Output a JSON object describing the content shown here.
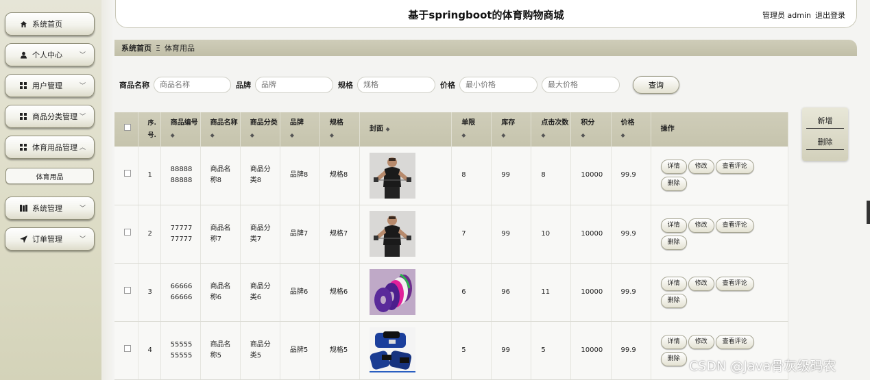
{
  "header": {
    "title": "基于springboot的体育购物商城",
    "role_user": "管理员 admin",
    "logout": "退出登录"
  },
  "sidebar": {
    "items": [
      {
        "label": "系统首页",
        "icon": "home-icon"
      },
      {
        "label": "个人中心",
        "icon": "user-icon"
      },
      {
        "label": "用户管理",
        "icon": "grid-icon"
      },
      {
        "label": "商品分类管理",
        "icon": "grid-icon"
      },
      {
        "label": "体育用品管理",
        "icon": "grid-icon"
      },
      {
        "label": "系统管理",
        "icon": "book-icon"
      },
      {
        "label": "订单管理",
        "icon": "send-icon"
      }
    ],
    "sub_item": "体育用品"
  },
  "breadcrumb": {
    "home": "系统首页",
    "sep": "Ξ",
    "current": "体育用品"
  },
  "search": {
    "name_label": "商品名称",
    "name_placeholder": "商品名称",
    "brand_label": "品牌",
    "brand_placeholder": "品牌",
    "spec_label": "规格",
    "spec_placeholder": "规格",
    "price_label": "价格",
    "min_placeholder": "最小价格",
    "max_placeholder": "最大价格",
    "query_button": "查询"
  },
  "side_actions": {
    "add": "新增",
    "delete": "删除"
  },
  "table": {
    "headers": {
      "index": "序.号.",
      "code": "商品编号",
      "name": "商品名称",
      "category": "商品分类",
      "brand": "品牌",
      "spec": "规格",
      "cover": "封面",
      "limit": "单限",
      "stock": "库存",
      "clicks": "点击次数",
      "points": "积分",
      "price": "价格",
      "ops": "操作"
    },
    "op_labels": {
      "detail": "详情",
      "edit": "修改",
      "review": "查看评论",
      "delete": "删除"
    },
    "rows": [
      {
        "index": "1",
        "code": "88888 88888",
        "name": "商品名称8",
        "category": "商品分类8",
        "brand": "品牌8",
        "spec": "规格8",
        "cover": "fitness-man-image",
        "limit": "8",
        "stock": "99",
        "clicks": "8",
        "points": "10000",
        "price": "99.9"
      },
      {
        "index": "2",
        "code": "77777 77777",
        "name": "商品名称7",
        "category": "商品分类7",
        "brand": "品牌7",
        "spec": "规格7",
        "cover": "fitness-man-image",
        "limit": "7",
        "stock": "99",
        "clicks": "10",
        "points": "10000",
        "price": "99.9"
      },
      {
        "index": "3",
        "code": "66666 66666",
        "name": "商品名称6",
        "category": "商品分类6",
        "brand": "品牌6",
        "spec": "规格6",
        "cover": "weight-plates-image",
        "limit": "6",
        "stock": "96",
        "clicks": "11",
        "points": "10000",
        "price": "99.9"
      },
      {
        "index": "4",
        "code": "55555 55555",
        "name": "商品名称5",
        "category": "商品分类5",
        "brand": "品牌5",
        "spec": "规格5",
        "cover": "ankle-weights-image",
        "limit": "5",
        "stock": "99",
        "clicks": "5",
        "points": "10000",
        "price": "99.9"
      }
    ]
  },
  "watermark": "CSDN @Java骨灰级码农"
}
